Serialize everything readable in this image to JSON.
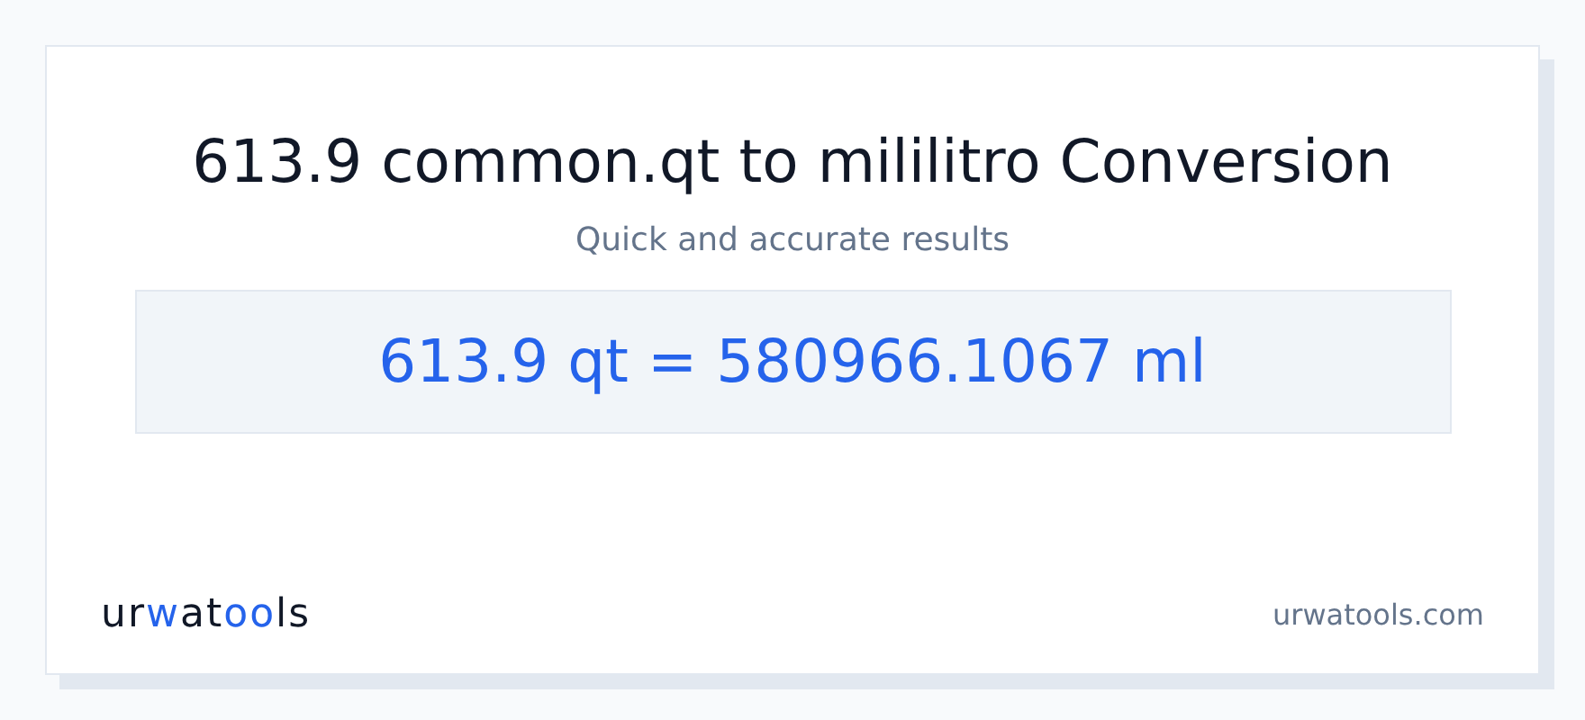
{
  "title": "613.9 common.qt to mililitro Conversion",
  "subtitle": "Quick and accurate results",
  "result": "613.9 qt = 580966.1067 ml",
  "logo": {
    "parts": [
      {
        "text": "ur",
        "accent": false
      },
      {
        "text": "w",
        "accent": true
      },
      {
        "text": "at",
        "accent": false
      },
      {
        "text": "oo",
        "accent": true
      },
      {
        "text": "ls",
        "accent": false
      }
    ]
  },
  "site": "urwatools.com"
}
